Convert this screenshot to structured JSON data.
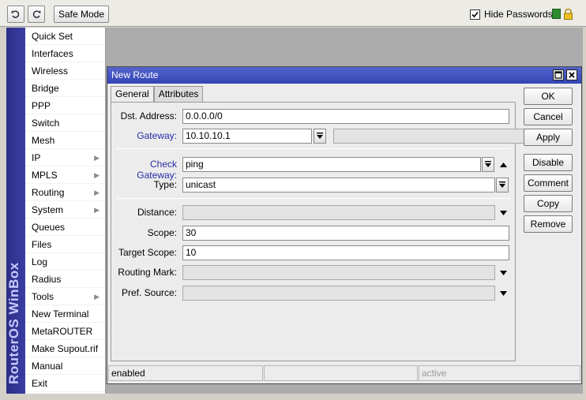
{
  "toolbar": {
    "undo_icon": "undo-icon",
    "redo_icon": "redo-icon",
    "safe_mode_label": "Safe Mode",
    "hide_passwords_label": "Hide Passwords",
    "hide_passwords_checked": true
  },
  "brand": {
    "text": "RouterOS WinBox"
  },
  "menu": {
    "items": [
      {
        "label": "Quick Set",
        "submenu": false
      },
      {
        "label": "Interfaces",
        "submenu": false
      },
      {
        "label": "Wireless",
        "submenu": false
      },
      {
        "label": "Bridge",
        "submenu": false
      },
      {
        "label": "PPP",
        "submenu": false
      },
      {
        "label": "Switch",
        "submenu": false
      },
      {
        "label": "Mesh",
        "submenu": false
      },
      {
        "label": "IP",
        "submenu": true
      },
      {
        "label": "MPLS",
        "submenu": true
      },
      {
        "label": "Routing",
        "submenu": true
      },
      {
        "label": "System",
        "submenu": true
      },
      {
        "label": "Queues",
        "submenu": false
      },
      {
        "label": "Files",
        "submenu": false
      },
      {
        "label": "Log",
        "submenu": false
      },
      {
        "label": "Radius",
        "submenu": false
      },
      {
        "label": "Tools",
        "submenu": true
      },
      {
        "label": "New Terminal",
        "submenu": false
      },
      {
        "label": "MetaROUTER",
        "submenu": false
      },
      {
        "label": "Make Supout.rif",
        "submenu": false
      },
      {
        "label": "Manual",
        "submenu": false
      },
      {
        "label": "Exit",
        "submenu": false
      }
    ]
  },
  "dialog": {
    "title": "New Route",
    "tabs": [
      {
        "label": "General",
        "active": true
      },
      {
        "label": "Attributes",
        "active": false
      }
    ],
    "fields": {
      "dst_address": {
        "label": "Dst. Address:",
        "value": "0.0.0.0/0"
      },
      "gateway": {
        "label": "Gateway:",
        "value": "10.10.10.1"
      },
      "check_gateway": {
        "label": "Check Gateway:",
        "value": "ping"
      },
      "type": {
        "label": "Type:",
        "value": "unicast"
      },
      "distance": {
        "label": "Distance:",
        "value": ""
      },
      "scope": {
        "label": "Scope:",
        "value": "30"
      },
      "target_scope": {
        "label": "Target Scope:",
        "value": "10"
      },
      "routing_mark": {
        "label": "Routing Mark:",
        "value": ""
      },
      "pref_source": {
        "label": "Pref. Source:",
        "value": ""
      }
    },
    "buttons": {
      "ok": "OK",
      "cancel": "Cancel",
      "apply": "Apply",
      "disable": "Disable",
      "comment": "Comment",
      "copy": "Copy",
      "remove": "Remove"
    },
    "status": {
      "state": "enabled",
      "middle": "",
      "active": "active"
    }
  },
  "colors": {
    "title_bar": "#3344b6",
    "brand_strip": "#2c2f86",
    "link_label": "#2a2aa8"
  }
}
